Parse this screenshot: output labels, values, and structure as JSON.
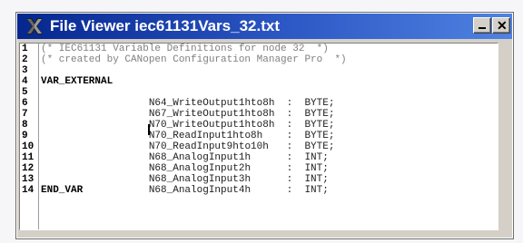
{
  "window": {
    "title": "File Viewer iec61131Vars_32.txt",
    "icon_name": "x-icon",
    "minimize_label": "_",
    "close_label": "✕"
  },
  "editor": {
    "line_numbers": [
      "1",
      "2",
      "3",
      "4",
      "5",
      "6",
      "7",
      "8",
      "9",
      "10",
      "11",
      "12",
      "13",
      "14"
    ],
    "lines": [
      "(* IEC61131 Variable Definitions for node 32  *)",
      "(* created by CANopen Configuration Manager Pro  *)",
      "",
      "VAR_EXTERNAL",
      "          N64_WriteOutput1hto8h  :  BYTE;",
      "          N67_WriteOutput1hto8h  :  BYTE;",
      "          N70_WriteOutput1hto8h  :  BYTE;",
      "          N70_ReadInput1hto8h    :  BYTE;",
      "          N70_ReadInput9hto10h   :  BYTE;",
      "          N68_AnalogInput1h      :  INT;",
      "          N68_AnalogInput2h      :  INT;",
      "          N68_AnalogInput3h      :  INT;",
      "          N68_AnalogInput4h      :  INT;",
      "END_VAR"
    ]
  },
  "colors": {
    "titlebar_start": "#05268f",
    "titlebar_end": "#4f82e1",
    "comment": "#7f7f7f",
    "type": "#0000c9"
  }
}
